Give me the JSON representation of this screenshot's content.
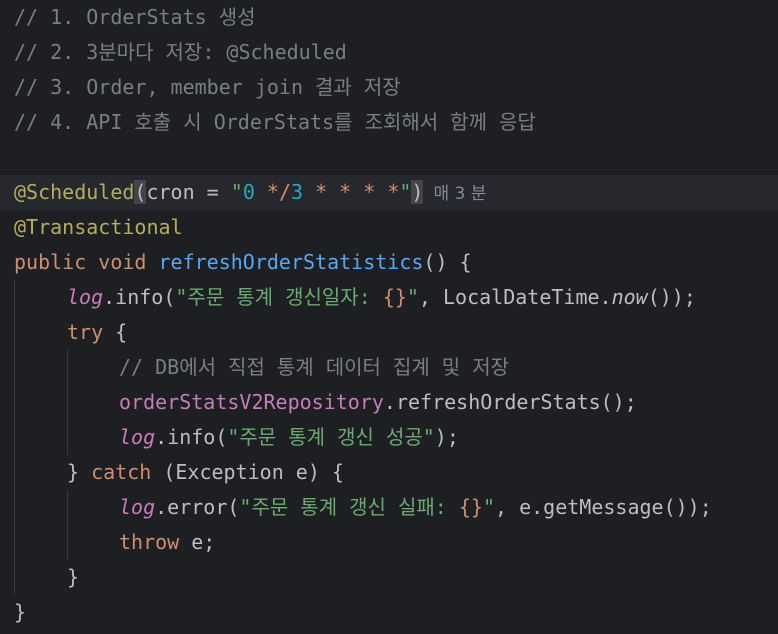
{
  "comments": {
    "c1": "// 1. OrderStats 생성",
    "c2": "// 2. 3분마다 저장: @Scheduled",
    "c3": "// 3. Order, member join 결과 저장",
    "c4": "// 4. API 호출 시 OrderStats를 조회해서 함께 응답"
  },
  "code": {
    "scheduled": "@Scheduled",
    "paren_open": "(",
    "cron_attr": "cron = ",
    "quote_open": "\"",
    "cron_0": "0 ",
    "cron_star_slash": "*/",
    "cron_3": "3",
    "cron_rest": " * * * *",
    "quote_close": "\"",
    "paren_close": ")",
    "cron_hint": "매 3 분",
    "transactional": "@Transactional",
    "kw_public": "public",
    "kw_void": "void",
    "method_name": "refreshOrderStatistics",
    "method_tail": "() {",
    "log": "log",
    "dot_info": ".info(",
    "str_log1_open": "\"주문 통계 갱신일자: ",
    "placeholder": "{}",
    "str_close_quote": "\"",
    "log1_tail": ", LocalDateTime.",
    "now": "now",
    "log1_end": "());",
    "kw_try": "try",
    "open_brace": " {",
    "comment_db": "// DB에서 직접 통계 데이터 집계 및 저장",
    "repo_field": "orderStatsV2Repository",
    "repo_call": ".refreshOrderStats();",
    "str_success": "\"주문 통계 갱신 성공\"",
    "paren_semicolon": ");",
    "close_brace": "}",
    "kw_catch": "catch",
    "catch_args": " (Exception e) {",
    "dot_error": ".error(",
    "str_fail_open": "\"주문 통계 갱신 실패: ",
    "error_tail": ", e.getMessage());",
    "kw_throw": "throw",
    "throw_tail": " e;"
  }
}
